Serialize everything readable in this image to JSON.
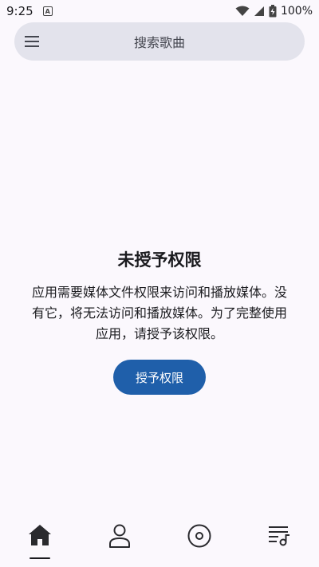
{
  "status_bar": {
    "time": "9:25",
    "battery_percent": "100%",
    "icons": [
      "a-notification-icon",
      "wifi-icon",
      "signal-icon",
      "battery-icon"
    ]
  },
  "search": {
    "placeholder": "搜索歌曲"
  },
  "permission": {
    "title": "未授予权限",
    "description": "应用需要媒体文件权限来访问和播放媒体。没有它，将无法访问和播放媒体。为了完整使用应用，请授予该权限。",
    "button_label": "授予权限"
  },
  "bottom_nav": {
    "items": [
      {
        "icon": "home-icon",
        "selected": true
      },
      {
        "icon": "person-icon",
        "selected": false
      },
      {
        "icon": "disc-icon",
        "selected": false
      },
      {
        "icon": "playlist-icon",
        "selected": false
      }
    ]
  },
  "colors": {
    "background": "#fbf8fd",
    "search_bar": "#e3e3ec",
    "accent": "#1f5faa",
    "text": "#1b1b1f"
  }
}
